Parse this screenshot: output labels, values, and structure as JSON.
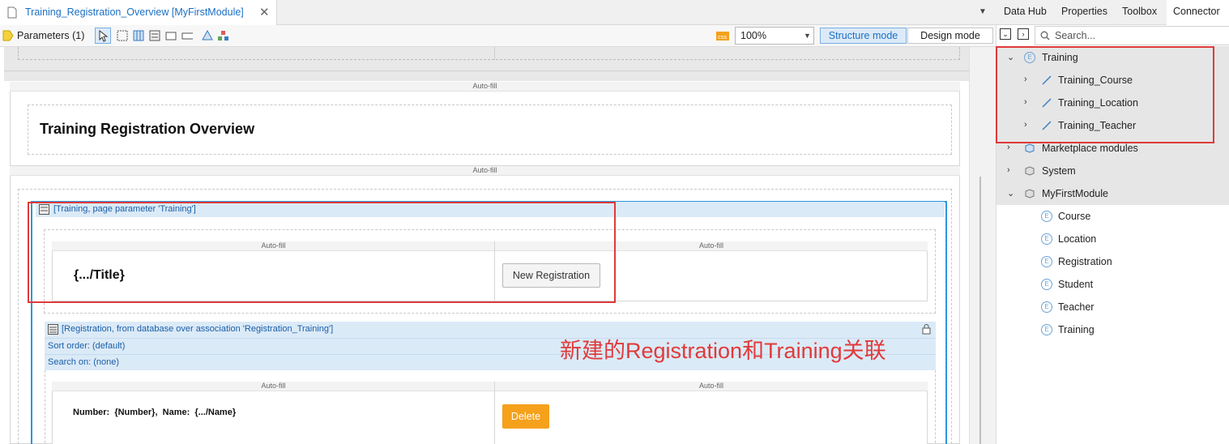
{
  "document_tab": {
    "title": "Training_Registration_Overview [MyFirstModule]"
  },
  "right_tabs": [
    "Data Hub",
    "Properties",
    "Toolbox",
    "Connector"
  ],
  "toolbar": {
    "parameters_label": "Parameters (1)",
    "zoom": "100%",
    "structure_mode": "Structure mode",
    "design_mode": "Design mode"
  },
  "search": {
    "placeholder": "Search..."
  },
  "canvas": {
    "autofill_label": "Auto-fill",
    "page_title": "Training Registration Overview",
    "dataview_header": "[Training, page parameter 'Training']",
    "title_field": "{.../Title}",
    "new_registration_button": "New Registration",
    "listview_header": "[Registration, from database over association 'Registration_Training']",
    "sort_order": "Sort order: (default)",
    "search_on": "Search on: (none)",
    "row_text": "Number:  {Number},  Name:  {.../Name}",
    "delete_button": "Delete",
    "annotation": "新建的Registration和Training关联"
  },
  "tree": {
    "training": "Training",
    "associations": [
      "Training_Course",
      "Training_Location",
      "Training_Teacher"
    ],
    "marketplace": "Marketplace modules",
    "system": "System",
    "module": "MyFirstModule",
    "entities": [
      "Course",
      "Location",
      "Registration",
      "Student",
      "Teacher",
      "Training"
    ]
  },
  "colors": {
    "accent": "#1a6fc4",
    "annotation_red": "#e03a3a",
    "delete_orange": "#f5a11c",
    "selection_blue": "#2b96e0"
  }
}
